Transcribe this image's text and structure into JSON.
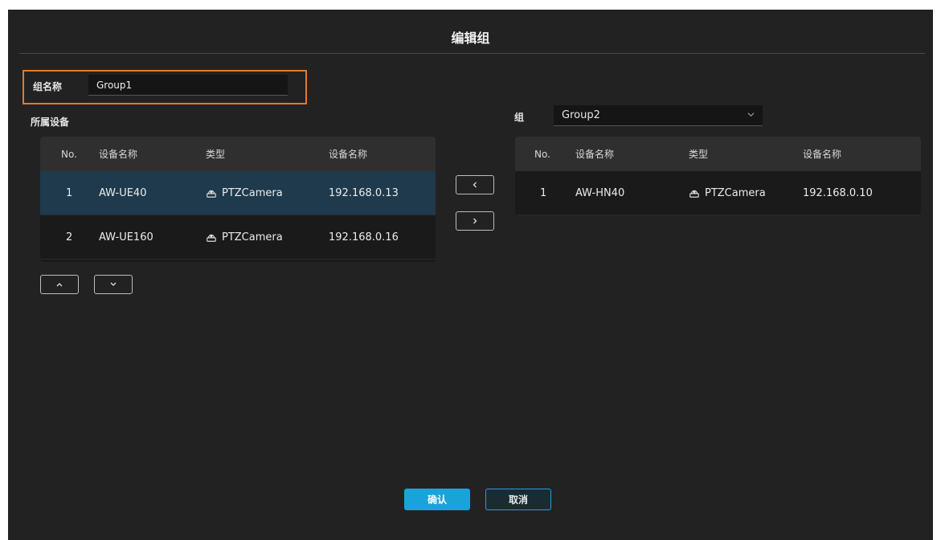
{
  "dialog": {
    "title": "编辑组"
  },
  "group_name": {
    "label": "组名称",
    "value": "Group1"
  },
  "left_section": {
    "label": "所属设备"
  },
  "right_group": {
    "label": "组",
    "selected": "Group2"
  },
  "left_table": {
    "headers": [
      "No.",
      "设备名称",
      "类型",
      "设备名称"
    ],
    "rows": [
      {
        "no": "1",
        "name": "AW-UE40",
        "type": "PTZCamera",
        "ip": "192.168.0.13",
        "selected": true
      },
      {
        "no": "2",
        "name": "AW-UE160",
        "type": "PTZCamera",
        "ip": "192.168.0.16",
        "selected": false
      }
    ]
  },
  "right_table": {
    "headers": [
      "No.",
      "设备名称",
      "类型",
      "设备名称"
    ],
    "rows": [
      {
        "no": "1",
        "name": "AW-HN40",
        "type": "PTZCamera",
        "ip": "192.168.0.10",
        "selected": false
      }
    ]
  },
  "icons": {
    "move_left": "chevron-left-icon",
    "move_right": "chevron-right-icon",
    "move_up": "chevron-up-icon",
    "move_down": "chevron-down-icon",
    "device_type": "camera-icon"
  },
  "footer": {
    "confirm_label": "确认",
    "cancel_label": "取消"
  },
  "colors": {
    "accent": "#1aa3d9",
    "highlight_border": "#e07b2e",
    "selected_row": "#1e3a4c",
    "background": "#222222"
  }
}
